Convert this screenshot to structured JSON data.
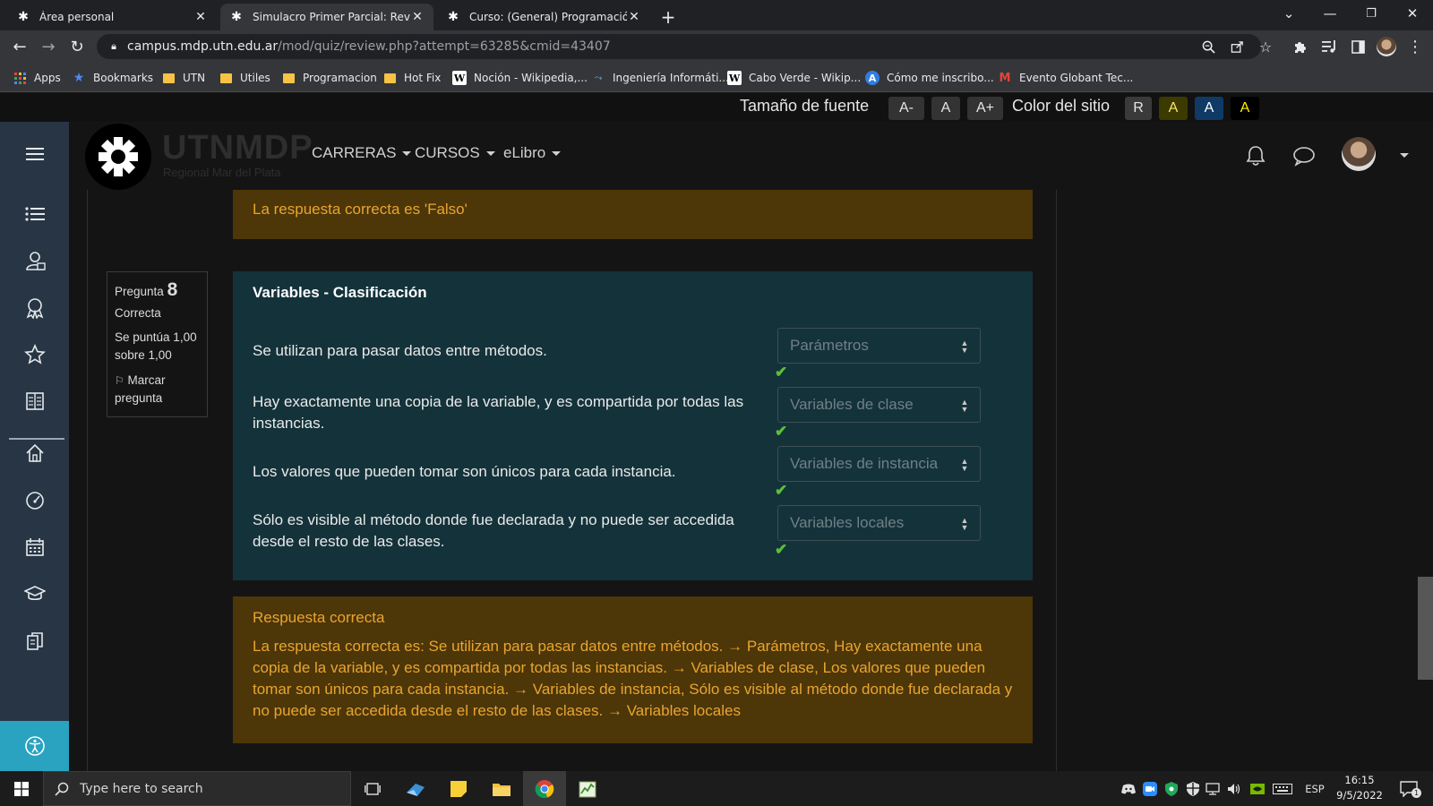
{
  "browser": {
    "tabs": [
      {
        "title": "Área personal",
        "active": false
      },
      {
        "title": "Simulacro Primer Parcial: Revisión",
        "active": true
      },
      {
        "title": "Curso: (General) Programación y",
        "active": false
      }
    ],
    "new_tab": "+",
    "url_host": "campus.mdp.utn.edu.ar",
    "url_path": "/mod/quiz/review.php?attempt=63285&cmid=43407",
    "bookmarks": [
      {
        "label": "Apps",
        "icon": "apps-grid-icon"
      },
      {
        "label": "Bookmarks",
        "icon": "star-icon"
      },
      {
        "label": "UTN",
        "icon": "folder-icon"
      },
      {
        "label": "Utiles",
        "icon": "folder-icon"
      },
      {
        "label": "Programacion",
        "icon": "folder-icon"
      },
      {
        "label": "Hot Fix",
        "icon": "folder-icon"
      },
      {
        "label": "Noción - Wikipedia,...",
        "icon": "wikipedia-icon"
      },
      {
        "label": "Ingeniería Informáti...",
        "icon": "site-icon"
      },
      {
        "label": "Cabo Verde - Wikip...",
        "icon": "wikipedia-icon"
      },
      {
        "label": "Cómo me inscribo...",
        "icon": "a-logo-icon"
      },
      {
        "label": "Evento Globant Tec...",
        "icon": "gmail-icon"
      }
    ]
  },
  "accessibility": {
    "font_size_label": "Tamaño de fuente",
    "font_buttons": [
      "A-",
      "A",
      "A+"
    ],
    "color_label": "Color del sitio",
    "color_buttons": [
      {
        "label": "R",
        "bg": "#3a3a3a",
        "fg": "#e6e6e6"
      },
      {
        "label": "A",
        "bg": "#3d3a00",
        "fg": "#f5e96a"
      },
      {
        "label": "A",
        "bg": "#0f3a66",
        "fg": "#ffffff"
      },
      {
        "label": "A",
        "bg": "#000000",
        "fg": "#fff200"
      }
    ]
  },
  "site": {
    "logo_text": "UTNMDP",
    "logo_subtitle": "Regional Mar del Plata",
    "menu": [
      "CARRERAS",
      "CURSOS",
      "eLibro"
    ]
  },
  "quiz": {
    "prev_feedback": "La respuesta correcta es 'Falso'",
    "question_label": "Pregunta",
    "question_number": "8",
    "state": "Correcta",
    "grade": "Se puntúa 1,00 sobre 1,00",
    "flag_label": "Marcar pregunta",
    "title": "Variables - Clasificación",
    "rows": [
      {
        "text": "Se utilizan para pasar datos entre métodos.",
        "answer": "Parámetros"
      },
      {
        "text": "Hay exactamente una copia de la variable, y es compartida por todas las instancias.",
        "answer": "Variables de clase"
      },
      {
        "text": "Los valores que pueden tomar son únicos para cada instancia.",
        "answer": "Variables de instancia"
      },
      {
        "text": "Sólo es visible al método donde fue declarada y no puede ser accedida desde el resto de las clases.",
        "answer": "Variables locales"
      }
    ],
    "feedback_title": "Respuesta correcta",
    "feedback_text": "La respuesta correcta es: Se utilizan para pasar datos entre métodos. → Parámetros, Hay exactamente una copia de la variable, y es compartida por todas las instancias. → Variables de clase, Los valores que pueden tomar son únicos para cada instancia. → Variables de instancia, Sólo es visible al método donde fue declarada y no puede ser accedida desde el resto de las clases. → Variables locales"
  },
  "taskbar": {
    "search_placeholder": "Type here to search",
    "language": "ESP",
    "time": "16:15",
    "date": "9/5/2022",
    "notification_count": "1"
  },
  "colors": {
    "drawer": "#273544",
    "question_bg": "#14323a",
    "feedback_bg": "#4d3608",
    "feedback_text": "#e8a530",
    "correct_check": "#5cbf3a"
  }
}
